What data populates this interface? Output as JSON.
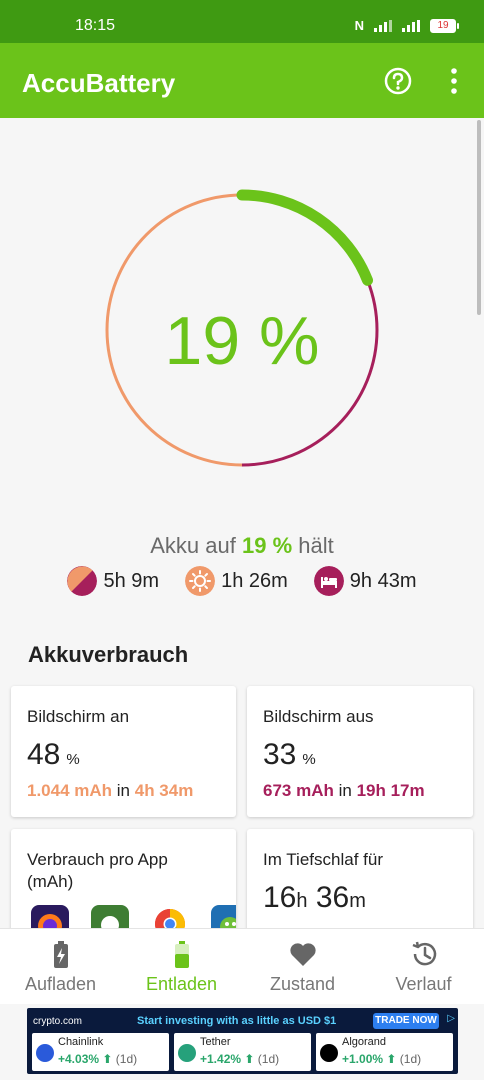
{
  "status_bar": {
    "time": "18:15",
    "battery_level": "19"
  },
  "app_bar": {
    "title": "AccuBattery"
  },
  "gauge": {
    "value_label": "19 %",
    "charge_percent": 19
  },
  "holds": {
    "prefix": "Akku auf",
    "value": "19 %",
    "suffix": "hält"
  },
  "estimates": [
    {
      "icon": "mixed-usage-icon",
      "value": "5h 9m"
    },
    {
      "icon": "screen-on-sun-icon",
      "value": "1h 26m"
    },
    {
      "icon": "sleep-bed-icon",
      "value": "9h 43m"
    }
  ],
  "section": {
    "title": "Akkuverbrauch"
  },
  "cards": {
    "screen_on": {
      "label": "Bildschirm an",
      "value": "48",
      "unit": "%",
      "mah": "1.044 mAh",
      "in": "in",
      "time": "4h 34m"
    },
    "screen_off": {
      "label": "Bildschirm aus",
      "value": "33",
      "unit": "%",
      "mah": "673 mAh",
      "in": "in",
      "time": "19h 17m"
    },
    "per_app": {
      "label": "Verbrauch pro App (mAh)"
    },
    "deep_sleep": {
      "label": "Im Tiefschlaf für",
      "hours": "16",
      "h": "h",
      "minutes": "36",
      "m": "m"
    }
  },
  "bottom_nav": [
    {
      "label": "Aufladen",
      "icon": "battery-charging-icon",
      "active": false
    },
    {
      "label": "Entladen",
      "icon": "battery-discharging-icon",
      "active": true
    },
    {
      "label": "Zustand",
      "icon": "heart-icon",
      "active": false
    },
    {
      "label": "Verlauf",
      "icon": "history-icon",
      "active": false
    }
  ],
  "ad": {
    "brand": "crypto.com",
    "headline": "Start investing with as little as USD $1",
    "cta": "TRADE NOW",
    "coins": [
      {
        "name": "Chainlink",
        "change": "+4.03%",
        "period": "(1d)"
      },
      {
        "name": "Tether",
        "change": "+1.42%",
        "period": "(1d)"
      },
      {
        "name": "Algorand",
        "change": "+1.00%",
        "period": "(1d)"
      }
    ]
  },
  "colors": {
    "accent": "#6bc31a",
    "status_bar": "#3f9a12",
    "orange": "#f0996a",
    "plum": "#a61f5b"
  }
}
